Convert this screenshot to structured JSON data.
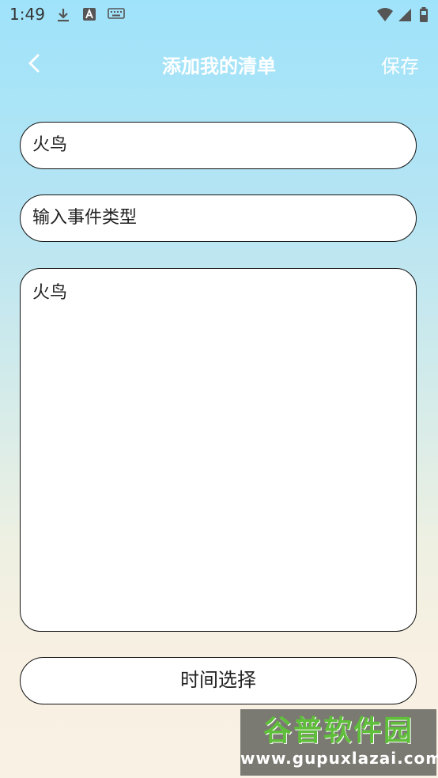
{
  "status_bar": {
    "time": "1:49",
    "left_icons": [
      "download-icon",
      "font-a-icon",
      "keyboard-icon"
    ],
    "right_icons": [
      "wifi-icon",
      "signal-icon",
      "battery-icon"
    ]
  },
  "app_bar": {
    "title": "添加我的清单",
    "save_label": "保存",
    "back_icon": "chevron-left-icon",
    "title_color": "#ffffff"
  },
  "form": {
    "name_value": "火鸟",
    "type_placeholder": "输入事件类型",
    "content_value": "火鸟",
    "time_button_label": "时间选择"
  },
  "watermark": {
    "logo_text": "谷普软件园",
    "url_text": "www.gupuxlazai.com"
  }
}
